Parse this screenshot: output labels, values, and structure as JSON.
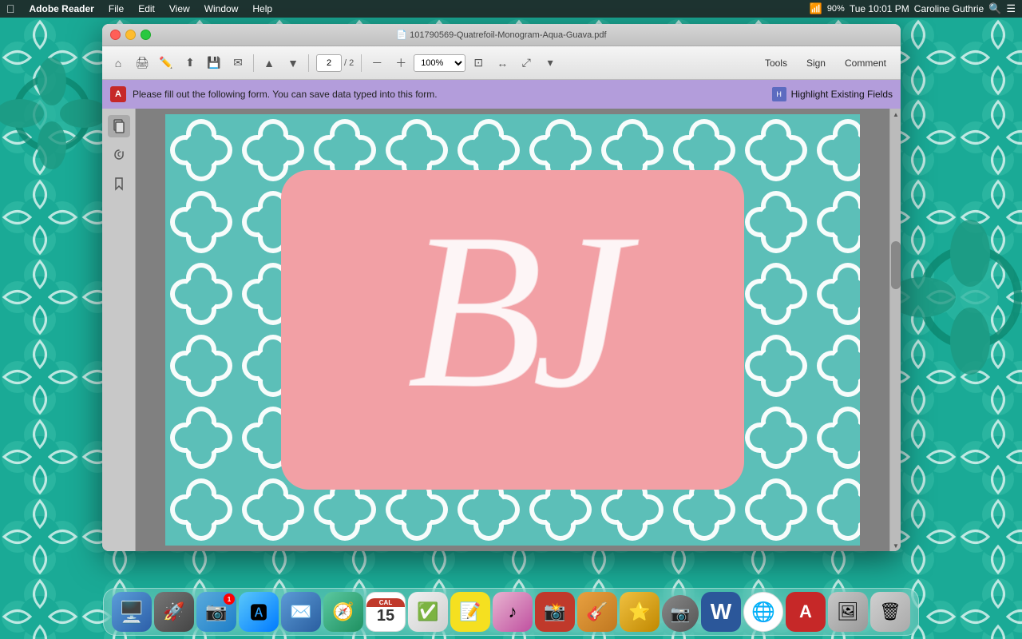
{
  "menubar": {
    "apple_symbol": "🍎",
    "items": [
      "Adobe Reader",
      "File",
      "Edit",
      "View",
      "Window",
      "Help"
    ],
    "status": {
      "battery_percent": "90%",
      "time": "Tue 10:01 PM",
      "user": "Caroline Guthrie"
    }
  },
  "window": {
    "title": "101790569-Quatrefoil-Monogram-Aqua-Guava.pdf",
    "controls": {
      "close": "close",
      "minimize": "minimize",
      "maximize": "maximize"
    },
    "toolbar": {
      "page_current": "2",
      "page_total": "2",
      "zoom": "100%",
      "tools_label": "Tools",
      "sign_label": "Sign",
      "comment_label": "Comment"
    },
    "form_bar": {
      "message": "Please fill out the following form. You can save data typed into this form.",
      "highlight_label": "Highlight Existing Fields"
    }
  },
  "pdf": {
    "monogram_letters": "BJ",
    "background_color": "#5bc8c0",
    "pink_color": "#f4a0a0"
  },
  "dock": {
    "items": [
      {
        "name": "Finder",
        "emoji": "🔵",
        "bg": "finder"
      },
      {
        "name": "Launchpad",
        "emoji": "🚀",
        "bg": "launchpad"
      },
      {
        "name": "Photos Library",
        "emoji": "📷",
        "bg": "photos"
      },
      {
        "name": "App Store",
        "emoji": "📦",
        "bg": "appstore"
      },
      {
        "name": "Mail",
        "emoji": "✉️",
        "bg": "mail"
      },
      {
        "name": "Safari",
        "emoji": "🧭",
        "bg": "safari"
      },
      {
        "name": "Calendar",
        "emoji": "15",
        "bg": "calendar"
      },
      {
        "name": "Reminders",
        "emoji": "✓",
        "bg": "reminders"
      },
      {
        "name": "Stickies",
        "emoji": "📝",
        "bg": "stickies"
      },
      {
        "name": "iTunes",
        "emoji": "♪",
        "bg": "itunes"
      },
      {
        "name": "iPhoto",
        "emoji": "📸",
        "bg": "photos2"
      },
      {
        "name": "GarageBand",
        "emoji": "🎸",
        "bg": "garageband"
      },
      {
        "name": "Camera",
        "emoji": "⭐",
        "bg": "camera"
      },
      {
        "name": "Word",
        "emoji": "W",
        "bg": "word"
      },
      {
        "name": "Chrome",
        "emoji": "🌐",
        "bg": "chrome"
      },
      {
        "name": "Acrobat",
        "emoji": "A",
        "bg": "acrobat"
      },
      {
        "name": "iPhoto Library",
        "emoji": "🖼",
        "bg": "iphoto"
      },
      {
        "name": "Trash",
        "emoji": "🗑",
        "bg": "trash"
      }
    ]
  }
}
